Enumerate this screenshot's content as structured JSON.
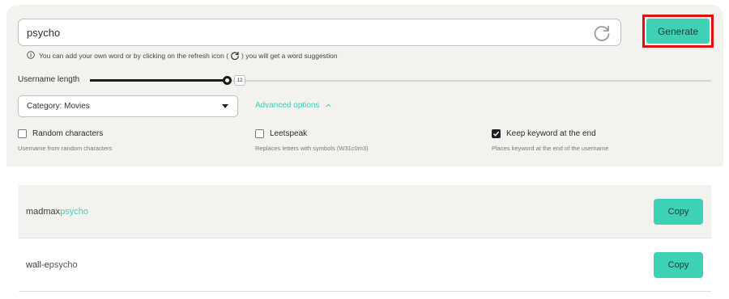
{
  "search": {
    "value": "psycho",
    "generate_label": "Generate",
    "hint_before": "You can add your own word or by clicking on the refresh icon (",
    "hint_after": ") you will get a word suggestion"
  },
  "length": {
    "label": "Username length",
    "value": "12",
    "fraction": 0.22
  },
  "category": {
    "selected": "Category: Movies"
  },
  "advanced": {
    "label": "Advanced options"
  },
  "options": [
    {
      "label": "Random characters",
      "description": "Username from random characters",
      "checked": false
    },
    {
      "label": "Leetspeak",
      "description": "Replaces letters with symbols (W31c0m3)",
      "checked": false
    },
    {
      "label": "Keep keyword at the end",
      "description": "Places keyword at the end of the username",
      "checked": true
    }
  ],
  "results": [
    {
      "prefix": "madmax",
      "keyword": "psycho",
      "copy_label": "Copy"
    },
    {
      "prefix": "wall-e",
      "keyword": "psycho",
      "copy_label": "Copy"
    }
  ],
  "colors": {
    "accent": "#3fd1b5",
    "highlight_border": "#e01010"
  },
  "icons": {
    "refresh": "refresh-icon",
    "info": "info-icon",
    "caret": "chevron-down-icon",
    "advanced": "chevron-up-icon",
    "check": "check-icon"
  }
}
